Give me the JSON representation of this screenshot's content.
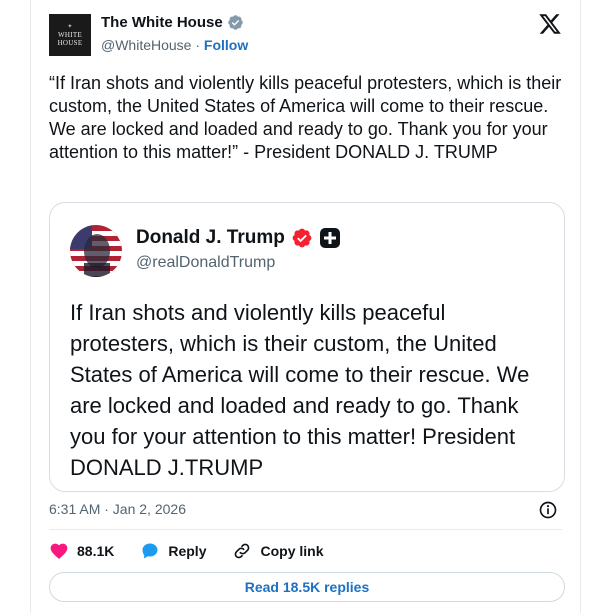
{
  "author": {
    "display_name": "The White House",
    "handle": "@WhiteHouse",
    "separator": " · ",
    "follow_label": "Follow",
    "avatar_text_line1": "WHITE",
    "avatar_text_line2": "HOUSE",
    "verified_color": "#829aab"
  },
  "tweet": {
    "text": "“If Iran shots and violently kills peaceful protesters, which is their custom, the United States of America will come to their rescue. We are locked and loaded and ready to go. Thank you for your attention to this matter!” - President DONALD J. TRUMP"
  },
  "quoted": {
    "display_name": "Donald J. Trump",
    "handle": "@realDonaldTrump",
    "verified_color": "#f4212e",
    "text": "If Iran shots and violently kills peaceful protesters, which is their custom, the United States of America will come to their rescue. We are locked and loaded and ready to go. Thank you for your attention to this matter! President DONALD J.TRUMP"
  },
  "meta": {
    "timestamp": "6:31 AM · Jan 2, 2026"
  },
  "actions": {
    "like_count": "88.1K",
    "reply_label": "Reply",
    "copy_link_label": "Copy link",
    "read_replies_label": "Read 18.5K replies"
  },
  "icons": [
    "x-logo-icon",
    "verified-badge-icon",
    "info-icon",
    "heart-icon",
    "reply-bubble-icon",
    "link-icon",
    "plus-badge-icon"
  ],
  "colors": {
    "link": "#1d70c2",
    "like": "#f91880",
    "reply": "#1d9bf0",
    "muted": "#536471"
  }
}
